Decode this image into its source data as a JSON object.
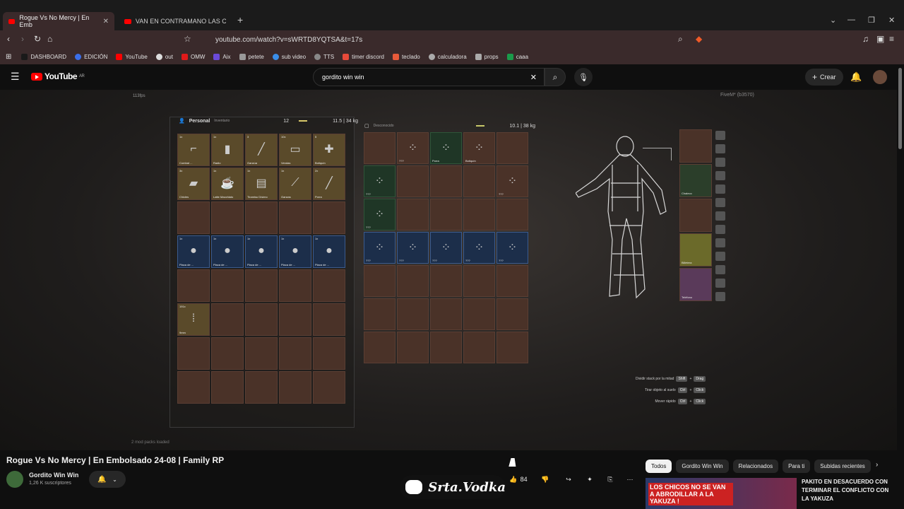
{
  "browser": {
    "tabs": [
      {
        "label": "Rogue Vs No Mercy | En Emb",
        "active": true
      },
      {
        "label": "VAN EN CONTRAMANO LAS CHICAS",
        "active": false
      }
    ],
    "url": "youtube.com/watch?v=sWRTD8YQTSA&t=17s",
    "bookmarks": [
      {
        "label": "DASHBOARD",
        "color": "#222222"
      },
      {
        "label": "EDICIÓN",
        "color": "#3a6ee8"
      },
      {
        "label": "YouTube",
        "color": "#ff0000"
      },
      {
        "label": "out",
        "color": "#dddddd"
      },
      {
        "label": "OMW",
        "color": "#e01a1a"
      },
      {
        "label": "Aix",
        "color": "#6b4ad8"
      },
      {
        "label": "petete",
        "color": "#999999"
      },
      {
        "label": "sub video",
        "color": "#3a8ee8"
      },
      {
        "label": "TTS",
        "color": "#888888"
      },
      {
        "label": "timer discord",
        "color": "#e84a3a"
      },
      {
        "label": "teclado",
        "color": "#e85a3a"
      },
      {
        "label": "calculadora",
        "color": "#aaaaaa"
      },
      {
        "label": "props",
        "color": "#aaaaaa"
      },
      {
        "label": "caaa",
        "color": "#1a9a4a"
      }
    ]
  },
  "youtube": {
    "logo": "YouTube",
    "region": "AR",
    "search_value": "gordito win win",
    "create_label": "Crear"
  },
  "video": {
    "fps": "113fps",
    "fivem": "FiveM* (b3570)",
    "personal_label": "Personal",
    "inventario_label": "Inventario",
    "personal_slots": "12",
    "personal_weight": "11.5 | 34 kg",
    "ground_label": "Desconocido",
    "ground_weight": "10.1 | 38 kg",
    "personal_items": [
      {
        "qty": "1x",
        "name": "Combat ...",
        "glyph": "⌐"
      },
      {
        "qty": "1x",
        "name": "Radio",
        "glyph": "▮"
      },
      {
        "qty": "3",
        "name": "Ganzúa",
        "glyph": "╱"
      },
      {
        "qty": "10x",
        "name": "Vendas",
        "glyph": "▭"
      },
      {
        "qty": "5",
        "name": "Botiquín",
        "glyph": "✚"
      },
      {
        "qty": "3x",
        "name": "Chicles",
        "glyph": "▰"
      },
      {
        "qty": "1x",
        "name": "Latte Macchiato",
        "glyph": "☕"
      },
      {
        "qty": "1x",
        "name": "Tiramisu Dísimo",
        "glyph": "▤"
      },
      {
        "qty": "1x",
        "name": "Ganzas",
        "glyph": "⟋"
      },
      {
        "qty": "2x",
        "name": "Porra",
        "glyph": "╱"
      }
    ],
    "plates": [
      {
        "qty": "1x",
        "name": "Placa de ..."
      },
      {
        "qty": "1x",
        "name": "Placa de ..."
      },
      {
        "qty": "1x",
        "name": "Placa de ..."
      },
      {
        "qty": "1x",
        "name": "Placa de ..."
      },
      {
        "qty": "1x",
        "name": "Placa de ..."
      }
    ],
    "ammo": {
      "qty": "191x",
      "name": "9mm"
    },
    "ground_items": [
      {
        "name": "???"
      },
      {
        "name": "Porra"
      },
      {
        "name": "Botiquín"
      },
      {
        "name": "???"
      },
      {
        "name": "???"
      },
      {
        "name": "???"
      }
    ],
    "equipment": [
      {
        "name": ""
      },
      {
        "name": "Chaleco"
      },
      {
        "name": ""
      },
      {
        "name": "Billetera"
      },
      {
        "name": "Teléfono"
      }
    ],
    "hints": [
      {
        "label": "Dividir stack por la mitad",
        "k1": "Shift",
        "k2": "Drag"
      },
      {
        "label": "Tirar objeto al suelo",
        "k1": "Ctrl",
        "k2": "Click"
      },
      {
        "label": "Mover rápido",
        "k1": "Ctrl",
        "k2": "Click"
      }
    ],
    "mods": "2 mod packs loaded"
  },
  "meta": {
    "title": "Rogue Vs No Mercy | En Embolsado 24-08 | Family RP",
    "channel": "Gordito Win Win",
    "subscribers": "1,26 K suscriptores",
    "likes": "84",
    "watermark": "Srta.Vodka"
  },
  "sidebar": {
    "chips": [
      "Todos",
      "Gordito Win Win",
      "Relacionados",
      "Para ti",
      "Subidas recientes"
    ],
    "rec_thumb_text": "LOS CHICOS NO SE VAN A ABRODILLAR A LA YAKUZA !",
    "rec_title": "PAKITO EN DESACUERDO CON TERMINAR EL CONFLICTO CON LA YAKUZA"
  }
}
